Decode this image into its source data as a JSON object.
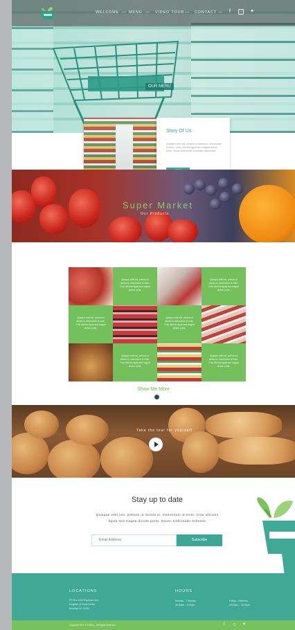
{
  "nav": {
    "items": [
      "WELCOME",
      "MENU",
      "VIDEO TOUR",
      "CONTACT"
    ],
    "social_icons": [
      "facebook-icon",
      "instagram-icon",
      "twitter-icon"
    ]
  },
  "hero": {
    "cart_label": "OUR MENU"
  },
  "story": {
    "title": "Story Of Us",
    "text": "Quisque velit nisi, pretium ut lacinia in, elementum id enim. Cras ultricies ligula sed magna dictum porta. Donec sollicitudin molestie malesuada.",
    "button": "MORE"
  },
  "banner": {
    "title": "Super Market",
    "subtitle": "Our Products"
  },
  "grid": {
    "cell_text": "Quisque velit nisi, pretium ut lacinia in, elementum id enim. Cras ultricies ligula sed magna dictum porta.",
    "show_more": "Show Me More"
  },
  "video": {
    "label": "Take the tour for yourself"
  },
  "newsletter": {
    "title": "Stay up to date",
    "text": "Quisque velit nisi, pretium ut lacinia in, elementum id enim. Cras ultricies ligula sed magna dictum porta. Donec sollicitudin molestie",
    "email_placeholder": "Email Address",
    "subscribe": "Subscribe"
  },
  "footer": {
    "locations_title": "LOCATIONS",
    "address": [
      "PO Box 1234 Espresso Ave.",
      "Kingdom of Good Drinks",
      "Brooklyn NY 11234"
    ],
    "hours_title": "HOURS",
    "hours_col1": [
      "Monday – Thursday",
      "08:00am – 9:00pm"
    ],
    "hours_col2": [
      "Friday – Saturday",
      "08:00am – 10:00pm"
    ],
    "copyright": "Copyright 2017 © Freshy – All Rights Reserved"
  },
  "colors": {
    "teal": "#3fa996",
    "green": "#77c25f",
    "grid_green": "#74c05d"
  }
}
